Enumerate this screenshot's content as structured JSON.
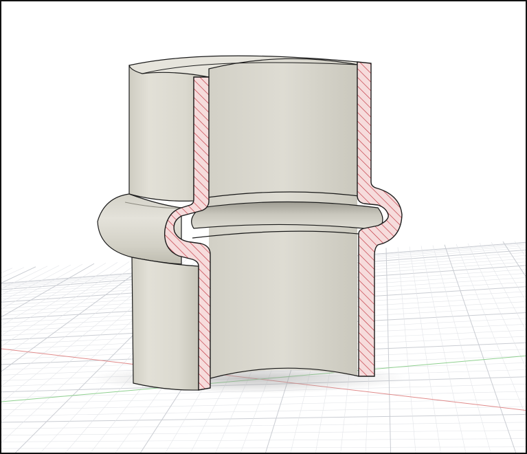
{
  "viewport": {
    "view_mode": "section-analysis",
    "background_color": "#ffffff",
    "frame_color": "#111111"
  },
  "ground_grid": {
    "grid_visible": true,
    "minor_line_color": "#e2e4e8",
    "major_line_color": "#c9ccd2",
    "x_axis_color": "#e08a8a",
    "y_axis_color": "#8fd08f"
  },
  "model": {
    "description_icon": "pipe-coupling-model",
    "body_color": "#d8d6cc",
    "edge_color": "#1a1a1a",
    "section_fill_color": "#f6dcdc",
    "section_hatch_color": "#c0303c"
  }
}
